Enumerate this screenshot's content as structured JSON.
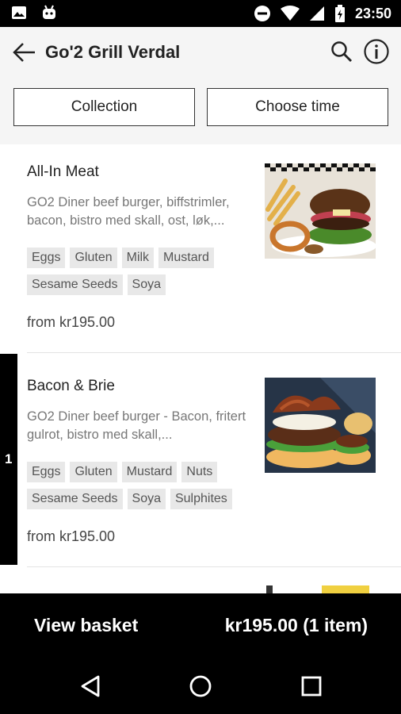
{
  "status_bar": {
    "time": "23:50",
    "icons": [
      "image-icon",
      "android-icon",
      "do-not-disturb-icon",
      "wifi-icon",
      "signal-icon",
      "battery-icon"
    ]
  },
  "app_bar": {
    "title": "Go'2 Grill Verdal",
    "icons": [
      "back-arrow-icon",
      "search-icon",
      "info-icon"
    ]
  },
  "filters": {
    "collection_label": "Collection",
    "time_label": "Choose time"
  },
  "menu_items": [
    {
      "name": "All-In Meat",
      "description": "GO2 Diner beef burger, biffstrimler, bacon, bistro med skall, ost, løk,...",
      "allergens": [
        "Eggs",
        "Gluten",
        "Milk",
        "Mustard",
        "Sesame Seeds",
        "Soya"
      ],
      "price": "from kr195.00"
    },
    {
      "name": "Bacon & Brie",
      "description": "GO2 Diner beef burger - Bacon, fritert gulrot, bistro med skall,...",
      "allergens": [
        "Eggs",
        "Gluten",
        "Mustard",
        "Nuts",
        "Sesame Seeds",
        "Soya",
        "Sulphites"
      ],
      "price": "from kr195.00",
      "quantity": "1"
    }
  ],
  "basket": {
    "label": "View basket",
    "total": "kr195.00 (1 item)"
  },
  "nav_bar": {
    "icons": [
      "back-triangle-icon",
      "home-circle-icon",
      "recents-square-icon"
    ]
  }
}
